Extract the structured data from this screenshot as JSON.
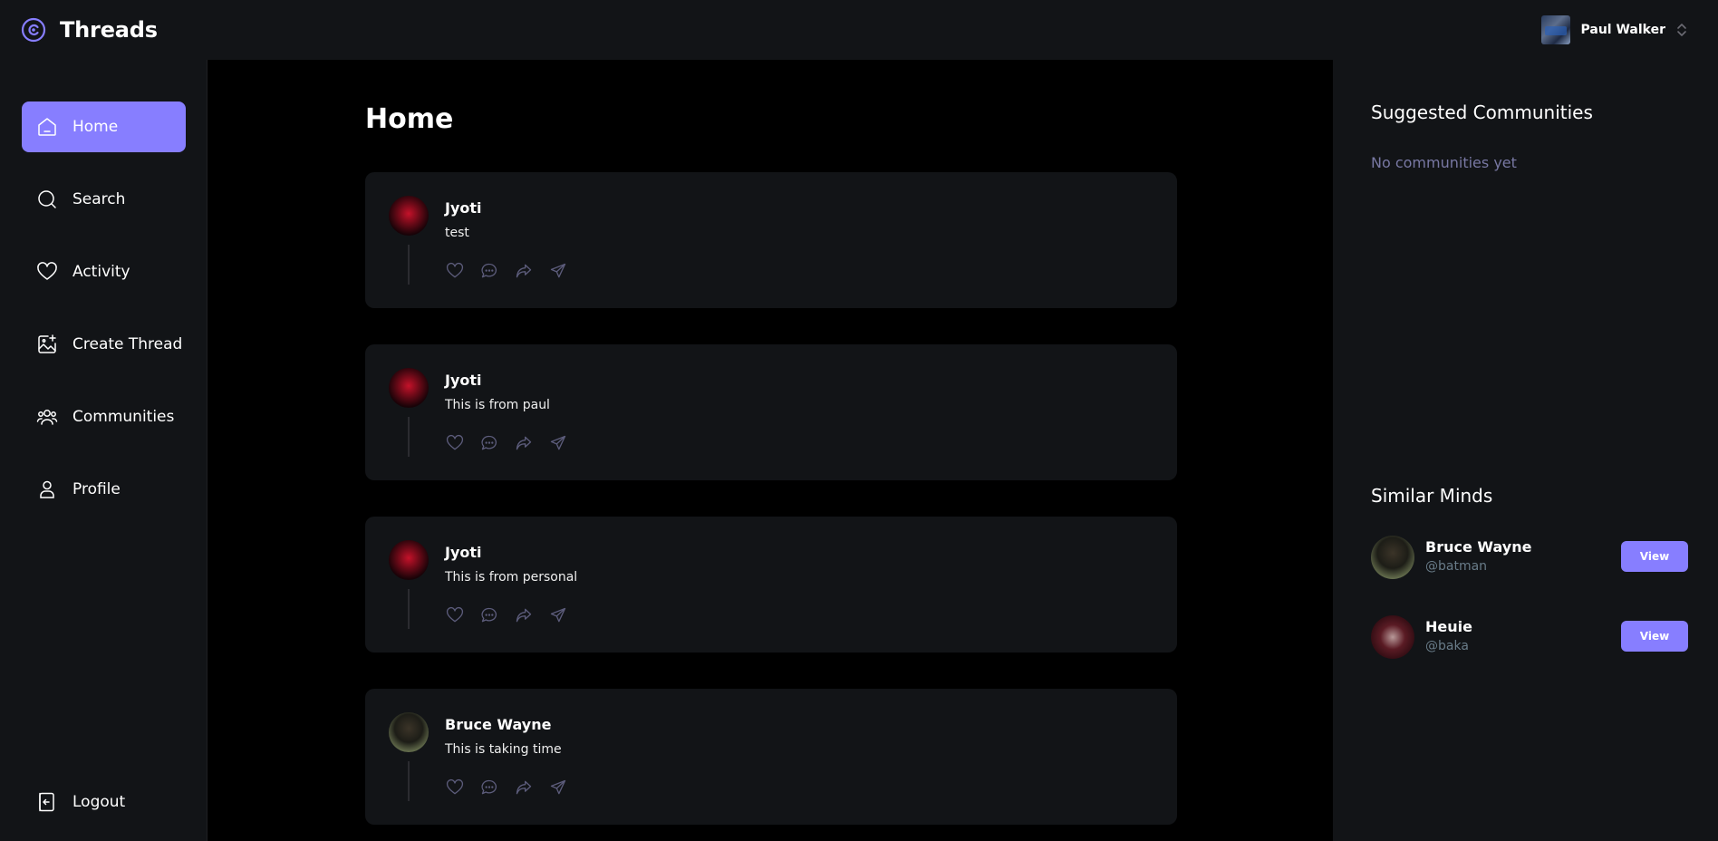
{
  "app": {
    "name": "Threads",
    "logo_icon": "threads-logo-icon",
    "accent": "#877EFF"
  },
  "header": {
    "user_name": "Paul Walker"
  },
  "sidebar": {
    "items": [
      {
        "label": "Home",
        "icon": "home-icon",
        "active": true
      },
      {
        "label": "Search",
        "icon": "search-icon",
        "active": false
      },
      {
        "label": "Activity",
        "icon": "heart-icon",
        "active": false
      },
      {
        "label": "Create Thread",
        "icon": "create-image-icon",
        "active": false
      },
      {
        "label": "Communities",
        "icon": "users-icon",
        "active": false
      },
      {
        "label": "Profile",
        "icon": "user-icon",
        "active": false
      }
    ],
    "logout_label": "Logout"
  },
  "main": {
    "title": "Home",
    "threads": [
      {
        "author": "Jyoti",
        "text": "test"
      },
      {
        "author": "Jyoti",
        "text": "This is from paul"
      },
      {
        "author": "Jyoti",
        "text": "This is from personal"
      },
      {
        "author": "Bruce Wayne",
        "text": "This is taking time"
      }
    ]
  },
  "right": {
    "suggested_title": "Suggested Communities",
    "no_communities": "No communities yet",
    "similar_title": "Similar Minds",
    "minds": [
      {
        "name": "Bruce Wayne",
        "handle": "@batman",
        "button": "View"
      },
      {
        "name": "Heuie",
        "handle": "@baka",
        "button": "View"
      }
    ]
  }
}
